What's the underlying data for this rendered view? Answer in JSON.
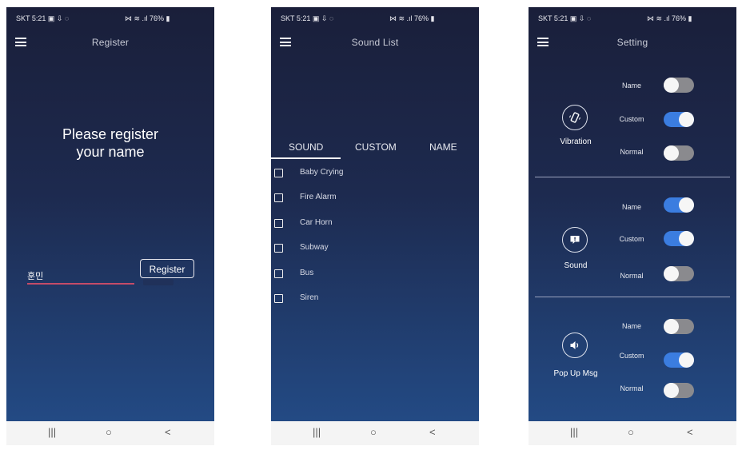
{
  "status_bar": {
    "left": "SKT 5:21 ▣ ⇩ ◌",
    "right": "⋈ ≋ .ıl 76% ▮"
  },
  "nav_icons": {
    "recents": "|||",
    "home": "○",
    "back": "<"
  },
  "register_screen": {
    "title": "Register",
    "prompt_line1": "Please register",
    "prompt_line2": "your name",
    "name_value": "훈민",
    "register_button": "Register"
  },
  "sound_list_screen": {
    "title": "Sound List",
    "tabs": [
      "SOUND",
      "CUSTOM",
      "NAME"
    ],
    "active_tab": "SOUND",
    "items": [
      "Baby Crying",
      "Fire Alarm",
      "Car Horn",
      "Subway",
      "Bus",
      "Siren"
    ]
  },
  "setting_screen": {
    "title": "Setting",
    "groups": [
      {
        "label": "Vibration",
        "icon": "vibration-icon",
        "options": [
          {
            "label": "Name",
            "on": false
          },
          {
            "label": "Custom",
            "on": true
          },
          {
            "label": "Normal",
            "on": false
          }
        ]
      },
      {
        "label": "Sound",
        "icon": "sound-alert-icon",
        "options": [
          {
            "label": "Name",
            "on": true
          },
          {
            "label": "Custom",
            "on": true
          },
          {
            "label": "Normal",
            "on": false
          }
        ]
      },
      {
        "label": "Pop Up Msg",
        "icon": "speaker-icon",
        "options": [
          {
            "label": "Name",
            "on": false
          },
          {
            "label": "Custom",
            "on": true
          },
          {
            "label": "Normal",
            "on": false
          }
        ]
      }
    ]
  },
  "colors": {
    "toggle_on": "#3b7de0",
    "toggle_off": "#8a8a8e",
    "input_underline": "#c44b68"
  }
}
